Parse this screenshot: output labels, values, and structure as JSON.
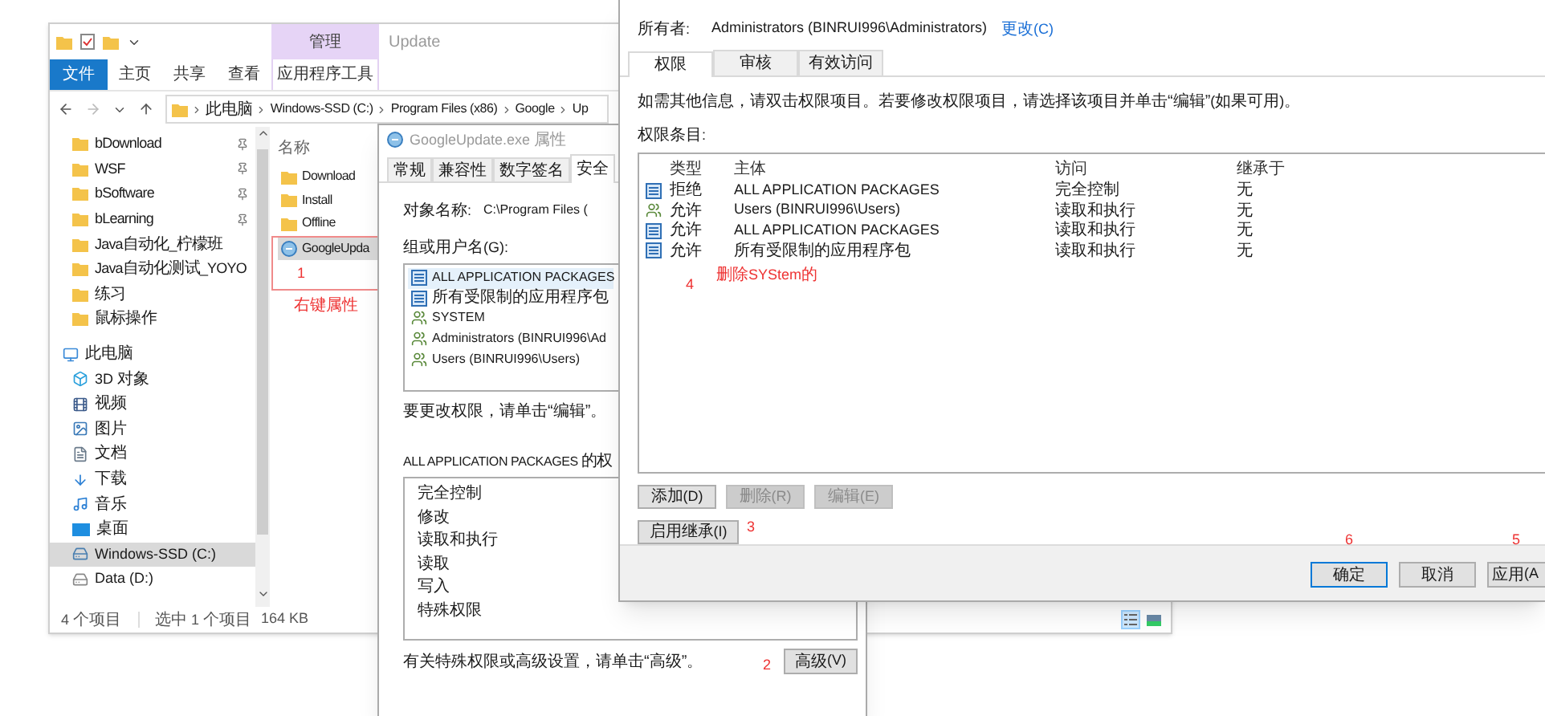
{
  "explorer": {
    "title": "Update",
    "context_group": "管理",
    "ribbon_tabs": [
      {
        "label": "文件",
        "kind": "file"
      },
      {
        "label": "主页",
        "kind": "tab"
      },
      {
        "label": "共享",
        "kind": "tab"
      },
      {
        "label": "查看",
        "kind": "tab"
      },
      {
        "label": "应用程序工具",
        "kind": "context"
      }
    ],
    "address": [
      "此电脑",
      "Windows-SSD (C:)",
      "Program Files (x86)",
      "Google",
      "Up"
    ],
    "quick_access": [
      {
        "label": "bDownload",
        "pinned": true
      },
      {
        "label": "WSF",
        "pinned": true
      },
      {
        "label": "bSoftware",
        "pinned": true
      },
      {
        "label": "bLearning",
        "pinned": true
      },
      {
        "label": "Java自动化_柠檬班",
        "pinned": false
      },
      {
        "label": "Java自动化测试_YOYO",
        "pinned": false
      },
      {
        "label": "练习",
        "pinned": false
      },
      {
        "label": "鼠标操作",
        "pinned": false
      }
    ],
    "this_pc": {
      "label": "此电脑",
      "children": [
        {
          "label": "3D 对象",
          "kind": "cube",
          "selected": false
        },
        {
          "label": "视频",
          "kind": "video",
          "selected": false
        },
        {
          "label": "图片",
          "kind": "picture",
          "selected": false
        },
        {
          "label": "文档",
          "kind": "document",
          "selected": false
        },
        {
          "label": "下载",
          "kind": "download",
          "selected": false
        },
        {
          "label": "音乐",
          "kind": "music",
          "selected": false
        },
        {
          "label": "桌面",
          "kind": "desktop",
          "selected": false
        },
        {
          "label": "Windows-SSD (C:)",
          "kind": "drive",
          "selected": true
        },
        {
          "label": "Data (D:)",
          "kind": "disk",
          "selected": false
        }
      ]
    },
    "file_list": {
      "column": "名称",
      "items": [
        {
          "name": "Download",
          "kind": "folder",
          "selected": false
        },
        {
          "name": "Install",
          "kind": "folder",
          "selected": false
        },
        {
          "name": "Offline",
          "kind": "folder",
          "selected": false
        },
        {
          "name": "GoogleUpda",
          "kind": "app",
          "selected": true
        }
      ],
      "note": "1",
      "caption": "右键属性"
    },
    "status_bar": [
      "4 个项目",
      "选中 1 个项目",
      "164 KB"
    ],
    "view_buttons": [
      {
        "kind": "details",
        "selected": true
      },
      {
        "kind": "tiles",
        "selected": false
      }
    ]
  },
  "properties": {
    "title": "GoogleUpdate.exe 属性",
    "tabs": [
      {
        "label": "常规",
        "selected": false
      },
      {
        "label": "兼容性",
        "selected": false
      },
      {
        "label": "数字签名",
        "selected": false
      },
      {
        "label": "安全",
        "selected": true
      }
    ],
    "object_label": "对象名称:",
    "object_value": "C:\\Program Files (",
    "group_label": "组或用户名(G):",
    "principals": [
      {
        "name": "ALL APPLICATION PACKAGES",
        "kind": "package",
        "selected": true
      },
      {
        "name": "所有受限制的应用程序包",
        "kind": "package",
        "selected": false
      },
      {
        "name": "SYSTEM",
        "kind": "users",
        "selected": false
      },
      {
        "name": "Administrators (BINRUI996\\Ad",
        "kind": "users",
        "selected": false
      },
      {
        "name": "Users (BINRUI996\\Users)",
        "kind": "users",
        "selected": false
      }
    ],
    "edit_hint": "要更改权限，请单击“编辑”。",
    "permissions_label": "ALL APPLICATION PACKAGES 的权",
    "permissions": [
      "完全控制",
      "修改",
      "读取和执行",
      "读取",
      "写入",
      "特殊权限"
    ],
    "advanced_hint": "有关特殊权限或高级设置，请单击“高级”。",
    "advanced_note": "2",
    "advanced_button": "高级(V)"
  },
  "security": {
    "owner_label": "所有者:",
    "owner": "Administrators (BINRUI996\\Administrators)",
    "change_link": "更改(C)",
    "tabs": [
      {
        "label": "权限",
        "selected": true
      },
      {
        "label": "审核",
        "selected": false
      },
      {
        "label": "有效访问",
        "selected": false
      }
    ],
    "info": "如需其他信息，请双击权限项目。若要修改权限项目，请选择该项目并单击“编辑”(如果可用)。",
    "entries_label": "权限条目:",
    "columns": [
      "类型",
      "主体",
      "访问",
      "继承于"
    ],
    "rows": [
      {
        "kind": "package",
        "type": "拒绝",
        "principal": "ALL APPLICATION PACKAGES",
        "access": "完全控制",
        "inherited": "无"
      },
      {
        "kind": "users",
        "type": "允许",
        "principal": "Users (BINRUI996\\Users)",
        "access": "读取和执行",
        "inherited": "无"
      },
      {
        "kind": "package",
        "type": "允许",
        "principal": "ALL APPLICATION PACKAGES",
        "access": "读取和执行",
        "inherited": "无"
      },
      {
        "kind": "package",
        "type": "允许",
        "principal": "所有受限制的应用程序包",
        "access": "读取和执行",
        "inherited": "无"
      }
    ],
    "table_note": "4",
    "table_caption": "删除SYStem的",
    "buttons": [
      {
        "label": "添加(D)",
        "disabled": false
      },
      {
        "label": "删除(R)",
        "disabled": true
      },
      {
        "label": "编辑(E)",
        "disabled": true
      }
    ],
    "inherit_button": "启用继承(I)",
    "inherit_note": "3",
    "dialog_buttons": [
      {
        "label": "确定",
        "note": "6",
        "focused": true
      },
      {
        "label": "取消",
        "focused": false
      },
      {
        "label": "应用(A",
        "note": "5",
        "focused": false
      }
    ]
  }
}
